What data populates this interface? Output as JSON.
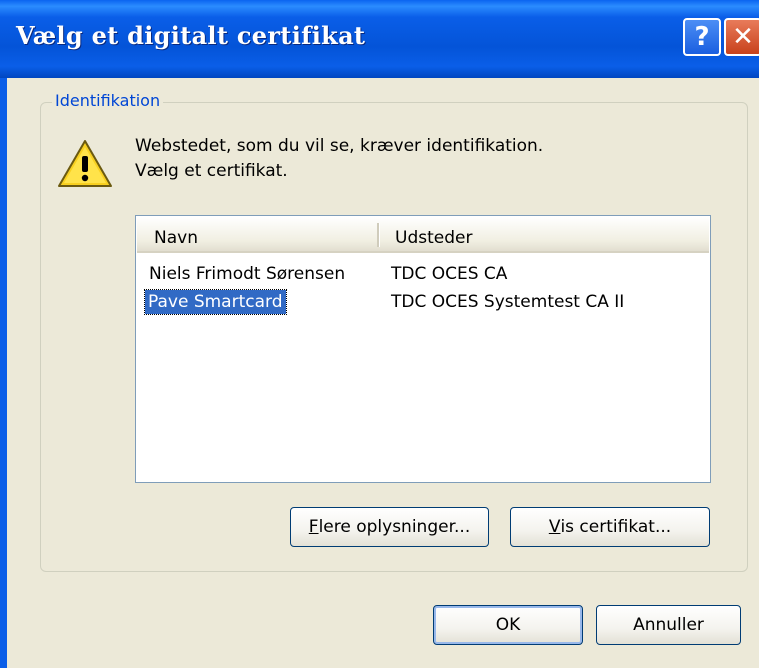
{
  "window": {
    "title": "Vælg et digitalt certifikat",
    "help_glyph": "?",
    "close_glyph": "✕"
  },
  "group": {
    "label": "Identifikation"
  },
  "message": {
    "line1": "Webstedet, som du vil se, kræver identifikation.",
    "line2": "Vælg et certifikat."
  },
  "list": {
    "columns": [
      "Navn",
      "Udsteder"
    ],
    "rows": [
      {
        "navn": "Niels Frimodt Sørensen",
        "udsteder": "TDC OCES CA",
        "selected": false
      },
      {
        "navn": "Pave Smartcard",
        "udsteder": "TDC OCES Systemtest CA II",
        "selected": true
      }
    ]
  },
  "buttons": {
    "more_info_prefix": "F",
    "more_info_rest": "lere oplysninger...",
    "view_cert_prefix": "V",
    "view_cert_rest": "is certifikat...",
    "ok": "OK",
    "cancel": "Annuller"
  },
  "icons": {
    "warning": "warning-icon",
    "help": "help-icon",
    "close": "close-icon"
  },
  "colors": {
    "titlebar": "#0a5ee8",
    "selection": "#316ac5",
    "group_label": "#0046d5"
  }
}
